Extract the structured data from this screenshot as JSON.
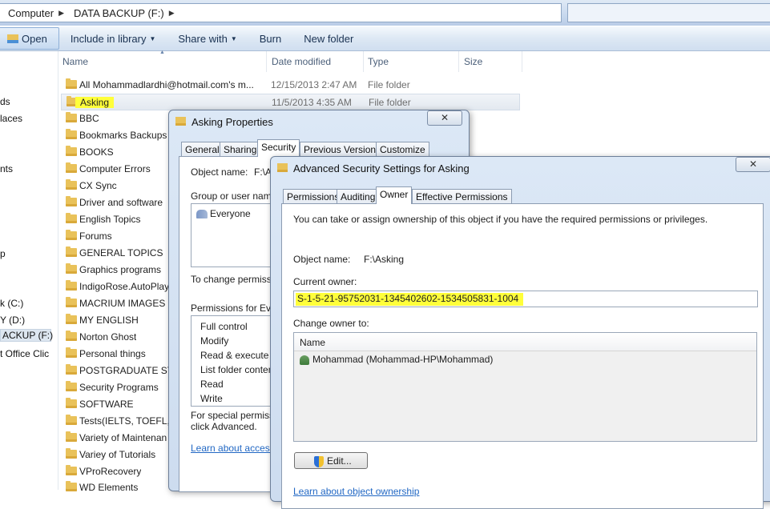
{
  "address": {
    "crumbs": [
      "Computer",
      "DATA BACKUP (F:)"
    ]
  },
  "toolbar": {
    "open": "Open",
    "include_in_library": "Include in library",
    "share_with": "Share with",
    "burn": "Burn",
    "new_folder": "New folder"
  },
  "nav": {
    "items": [
      "ds",
      "laces",
      "nts",
      "p",
      "k (C:)",
      "Y (D:)",
      "ACKUP (F:)",
      "t Office Clic"
    ]
  },
  "columns": {
    "name": "Name",
    "date": "Date modified",
    "type": "Type",
    "size": "Size"
  },
  "files": [
    {
      "name": "All Mohammadlardhi@hotmail.com's m...",
      "date": "12/15/2013 2:47 AM",
      "type": "File folder"
    },
    {
      "name": "Asking",
      "date": "11/5/2013 4:35 AM",
      "type": "File folder"
    },
    {
      "name": "BBC"
    },
    {
      "name": "Bookmarks Backups"
    },
    {
      "name": "BOOKS"
    },
    {
      "name": "Computer Errors"
    },
    {
      "name": "CX Sync"
    },
    {
      "name": "Driver and software"
    },
    {
      "name": "English Topics"
    },
    {
      "name": "Forums"
    },
    {
      "name": "GENERAL TOPICS"
    },
    {
      "name": "Graphics programs"
    },
    {
      "name": "IndigoRose.AutoPlay"
    },
    {
      "name": "MACRIUM IMAGES"
    },
    {
      "name": "MY ENGLISH"
    },
    {
      "name": "Norton Ghost"
    },
    {
      "name": "Personal things"
    },
    {
      "name": "POSTGRADUATE STU"
    },
    {
      "name": "Security Programs"
    },
    {
      "name": "SOFTWARE"
    },
    {
      "name": "Tests(IELTS, TOEFL, G"
    },
    {
      "name": "Variety of Maintenan"
    },
    {
      "name": "Variey of Tutorials"
    },
    {
      "name": "VProRecovery"
    },
    {
      "name": "WD Elements"
    }
  ],
  "props": {
    "title": "Asking Properties",
    "close": "✕",
    "tabs": [
      "General",
      "Sharing",
      "Security",
      "Previous Versions",
      "Customize"
    ],
    "object_name_label": "Object name:",
    "object_name_value": "F:\\A",
    "groups_label": "Group or user names",
    "group_everyone": "Everyone",
    "to_change": "To change permissio",
    "perms_for": "Permissions for Every",
    "permissions": [
      "Full control",
      "Modify",
      "Read & execute",
      "List folder contents",
      "Read",
      "Write"
    ],
    "special_1": "For special permission",
    "special_2": "click Advanced.",
    "learn": "Learn about access c"
  },
  "adv": {
    "title": "Advanced Security Settings for Asking",
    "close": "✕",
    "tabs": [
      "Permissions",
      "Auditing",
      "Owner",
      "Effective Permissions"
    ],
    "intro": "You can take or assign ownership of this object if you have the required permissions or privileges.",
    "object_name_label": "Object name:",
    "object_name_value": "F:\\Asking",
    "current_owner_label": "Current owner:",
    "current_owner_value": "S-1-5-21-95752031-1345402602-1534505831-1004",
    "change_owner_label": "Change owner to:",
    "list_header": "Name",
    "list_items": [
      "Mohammad (Mohammad-HP\\Mohammad)"
    ],
    "edit_button": "Edit...",
    "learn": "Learn about object ownership"
  },
  "colors": {
    "highlight": "#ffff3a",
    "link": "#2268c4"
  }
}
